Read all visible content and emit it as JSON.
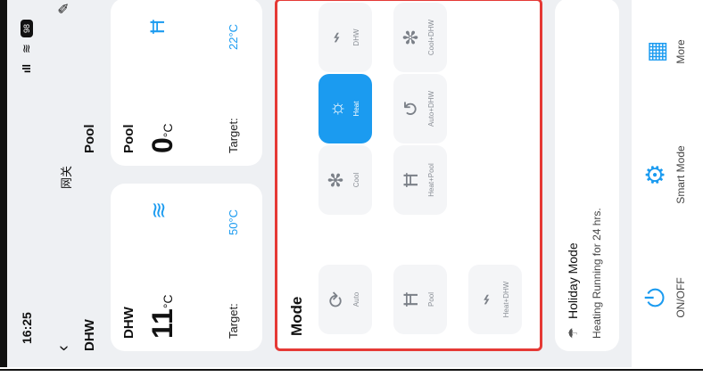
{
  "status_bar": {
    "time": "16:25",
    "battery": "98"
  },
  "header": {
    "title": "网关",
    "section_dhw": "DHW",
    "section_pool": "Pool"
  },
  "dhw_card": {
    "title": "DHW",
    "temp": "11",
    "unit": "°C",
    "target_label": "Target:",
    "target_value": "50°C"
  },
  "pool_card": {
    "title": "Pool",
    "temp": "0",
    "unit": "°C",
    "target_label": "Target:",
    "target_value": "22°C"
  },
  "mode": {
    "title": "Mode",
    "tiles": [
      {
        "label": "Auto",
        "icon": "auto-icon"
      },
      {
        "label": "Cool",
        "icon": "snowflake-icon"
      },
      {
        "label": "Heat",
        "icon": "sun-icon",
        "active": true
      },
      {
        "label": "DHW",
        "icon": "dhw-icon"
      },
      {
        "label": "Pool",
        "icon": "pool-icon"
      },
      {
        "label": "Heat+Pool",
        "icon": "heat-pool-icon"
      },
      {
        "label": "Auto+DHW",
        "icon": "auto-dhw-icon"
      },
      {
        "label": "Cool+DHW",
        "icon": "cool-dhw-icon"
      },
      {
        "label": "Heat+DHW",
        "icon": "heat-dhw-icon"
      }
    ],
    "highlight_color": "#e53935"
  },
  "holiday": {
    "title": "Holiday Mode",
    "subtitle": "Heating Running for 24 hrs."
  },
  "bottom_bar": {
    "onoff": "ON/OFF",
    "smart": "Smart Mode",
    "more": "More"
  },
  "colors": {
    "accent": "#1b9bf0",
    "active_tile": "#1b9bf0"
  }
}
